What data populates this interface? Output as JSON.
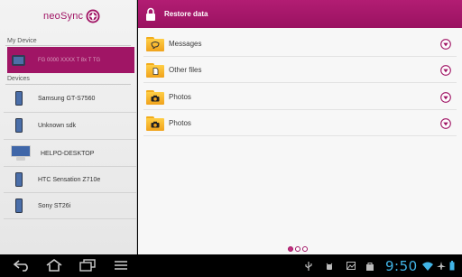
{
  "brand": {
    "name": "neoSync"
  },
  "sidebar": {
    "my_device_label": "My Device",
    "my_device_name": "FG 0000 XXXX T 8x T  TG",
    "devices_label": "Devices",
    "devices": [
      {
        "name": "Samsung GT-S7560",
        "icon": "phone-icon"
      },
      {
        "name": "Unknown sdk",
        "icon": "phone-icon"
      },
      {
        "name": "HELPO-DESKTOP",
        "icon": "monitor-icon"
      },
      {
        "name": "HTC Sensation Z710e",
        "icon": "phone-icon"
      },
      {
        "name": "Sony ST26i",
        "icon": "phone-icon"
      }
    ]
  },
  "header": {
    "title": "Restore data"
  },
  "items": [
    {
      "label": "Messages",
      "icon": "message-folder-icon"
    },
    {
      "label": "Other files",
      "icon": "file-folder-icon"
    },
    {
      "label": "Photos",
      "icon": "camera-folder-icon"
    },
    {
      "label": "Photos",
      "icon": "camera-folder-icon"
    }
  ],
  "pager": {
    "pages": 3,
    "current": 1
  },
  "status": {
    "time": "9:50"
  },
  "colors": {
    "accent": "#a01565",
    "clock": "#41b4e6",
    "folder": "#f5b222"
  }
}
